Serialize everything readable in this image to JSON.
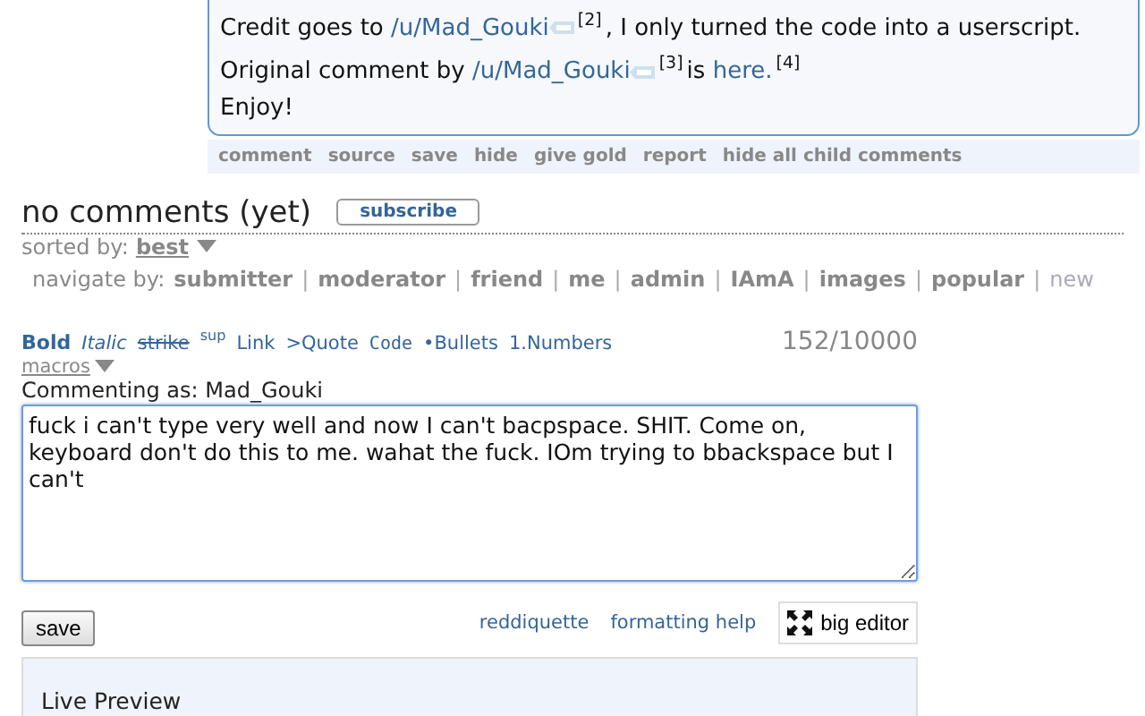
{
  "comment_body": {
    "lines": [
      [
        {
          "kind": "text",
          "text": "Credit goes to "
        },
        {
          "kind": "user",
          "text": "/u/Mad_Gouki"
        },
        {
          "kind": "sup",
          "text": "[2]"
        },
        {
          "kind": "text",
          "text": ", I only turned the code into a userscript."
        }
      ],
      [
        {
          "kind": "text",
          "text": "Original comment by "
        },
        {
          "kind": "user",
          "text": "/u/Mad_Gouki"
        },
        {
          "kind": "sup",
          "text": "[3]"
        },
        {
          "kind": "text",
          "text": "is "
        },
        {
          "kind": "link",
          "text": "here."
        },
        {
          "kind": "sup",
          "text": "[4]"
        }
      ],
      [
        {
          "kind": "text",
          "text": "Enjoy!"
        }
      ]
    ]
  },
  "comment_actions": [
    "comment",
    "source",
    "save",
    "hide",
    "give gold",
    "report",
    "hide all child comments"
  ],
  "comments_header": {
    "title": "no comments (yet)",
    "subscribe_button": "subscribe"
  },
  "sort": {
    "label": "sorted by:",
    "value": "best"
  },
  "navigate": {
    "label": "navigate by:",
    "separator": "|",
    "items": [
      {
        "text": "submitter",
        "disabled": false
      },
      {
        "text": "moderator",
        "disabled": false
      },
      {
        "text": "friend",
        "disabled": false
      },
      {
        "text": "me",
        "disabled": false
      },
      {
        "text": "admin",
        "disabled": false
      },
      {
        "text": "IAmA",
        "disabled": false
      },
      {
        "text": "images",
        "disabled": false
      },
      {
        "text": "popular",
        "disabled": false
      },
      {
        "text": "new",
        "disabled": true
      }
    ]
  },
  "editor": {
    "tools": [
      {
        "kind": "bold",
        "text": "Bold"
      },
      {
        "kind": "italic",
        "text": "Italic"
      },
      {
        "kind": "strike",
        "text": "strike"
      },
      {
        "kind": "sup",
        "text": "sup"
      },
      {
        "kind": "plain",
        "text": "Link"
      },
      {
        "kind": "plain",
        "text": ">Quote"
      },
      {
        "kind": "code",
        "text": "Code"
      },
      {
        "kind": "plain",
        "text": "•Bullets"
      },
      {
        "kind": "plain",
        "text": "1.Numbers"
      }
    ],
    "counter": "152/10000",
    "macros": "macros",
    "commenting_as": "Commenting as: Mad_Gouki",
    "value": "fuck i can't type very well and now I can't bacpspace. SHIT. Come on, keyboard don't do this to me. wahat the fuck. IOm trying to bbackspace but I can't",
    "save_button": "save",
    "links": [
      "reddiquette",
      "formatting help"
    ],
    "big_editor": "big editor",
    "preview_title": "Live Preview"
  }
}
